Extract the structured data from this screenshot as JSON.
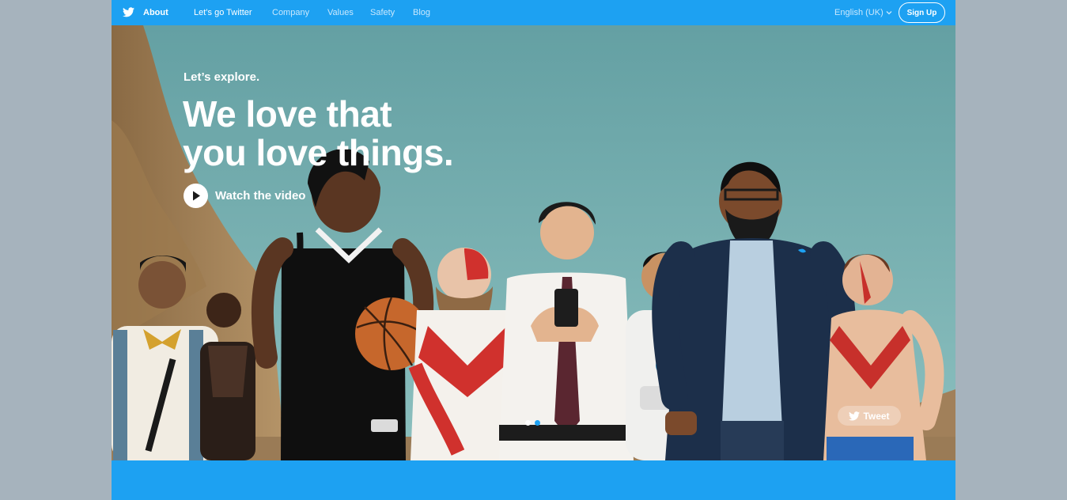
{
  "nav": {
    "logo_icon": "twitter-bird-icon",
    "about": "About",
    "links": [
      "Let’s go Twitter",
      "Company",
      "Values",
      "Safety",
      "Blog"
    ],
    "language": "English (UK)",
    "signup": "Sign Up"
  },
  "hero": {
    "kicker": "Let’s explore.",
    "title_line1": "We love that",
    "title_line2": "you love things.",
    "watch_label": "Watch the video",
    "play_icon": "play-icon",
    "slides_total": 2,
    "slide_active": 1,
    "tweet_label": "Tweet"
  },
  "colors": {
    "brand": "#1da1f2",
    "page_bg": "#a6b3bd",
    "sky": "#74b2b2"
  }
}
